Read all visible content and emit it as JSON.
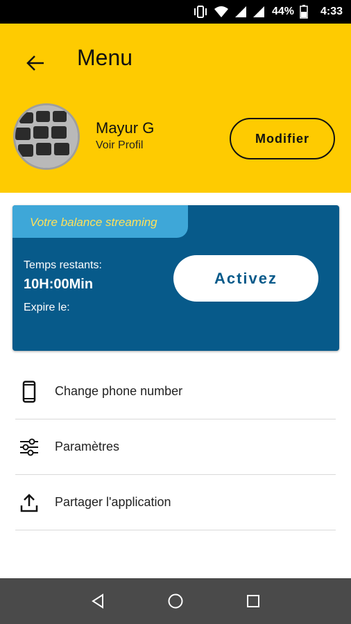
{
  "status_bar": {
    "battery_percent": "44%",
    "time": "4:33",
    "icons": [
      "vibrate-icon",
      "wifi-icon",
      "signal-icon",
      "signal-icon",
      "battery-icon"
    ]
  },
  "header": {
    "title": "Menu",
    "back_icon": "arrow-left-icon",
    "user_name": "Mayur G",
    "view_profile": "Voir Profil",
    "edit_label": "Modifier",
    "background_color": "#fecb01"
  },
  "balance": {
    "tab_label": "Votre balance streaming",
    "remaining_label": "Temps restants:",
    "remaining_value": "10H:00Min",
    "expires_label": "Expire le:",
    "activate_label": "Activez",
    "card_color": "#075a8a",
    "tab_color": "#3ea7d8"
  },
  "menu": {
    "items": [
      {
        "label": "Change phone number",
        "icon": "smartphone-icon"
      },
      {
        "label": "Paramètres",
        "icon": "sliders-icon"
      },
      {
        "label": "Partager l'application",
        "icon": "share-upload-icon"
      }
    ]
  },
  "nav_bar": {
    "buttons": [
      "back-triangle-icon",
      "home-circle-icon",
      "recents-square-icon"
    ]
  }
}
